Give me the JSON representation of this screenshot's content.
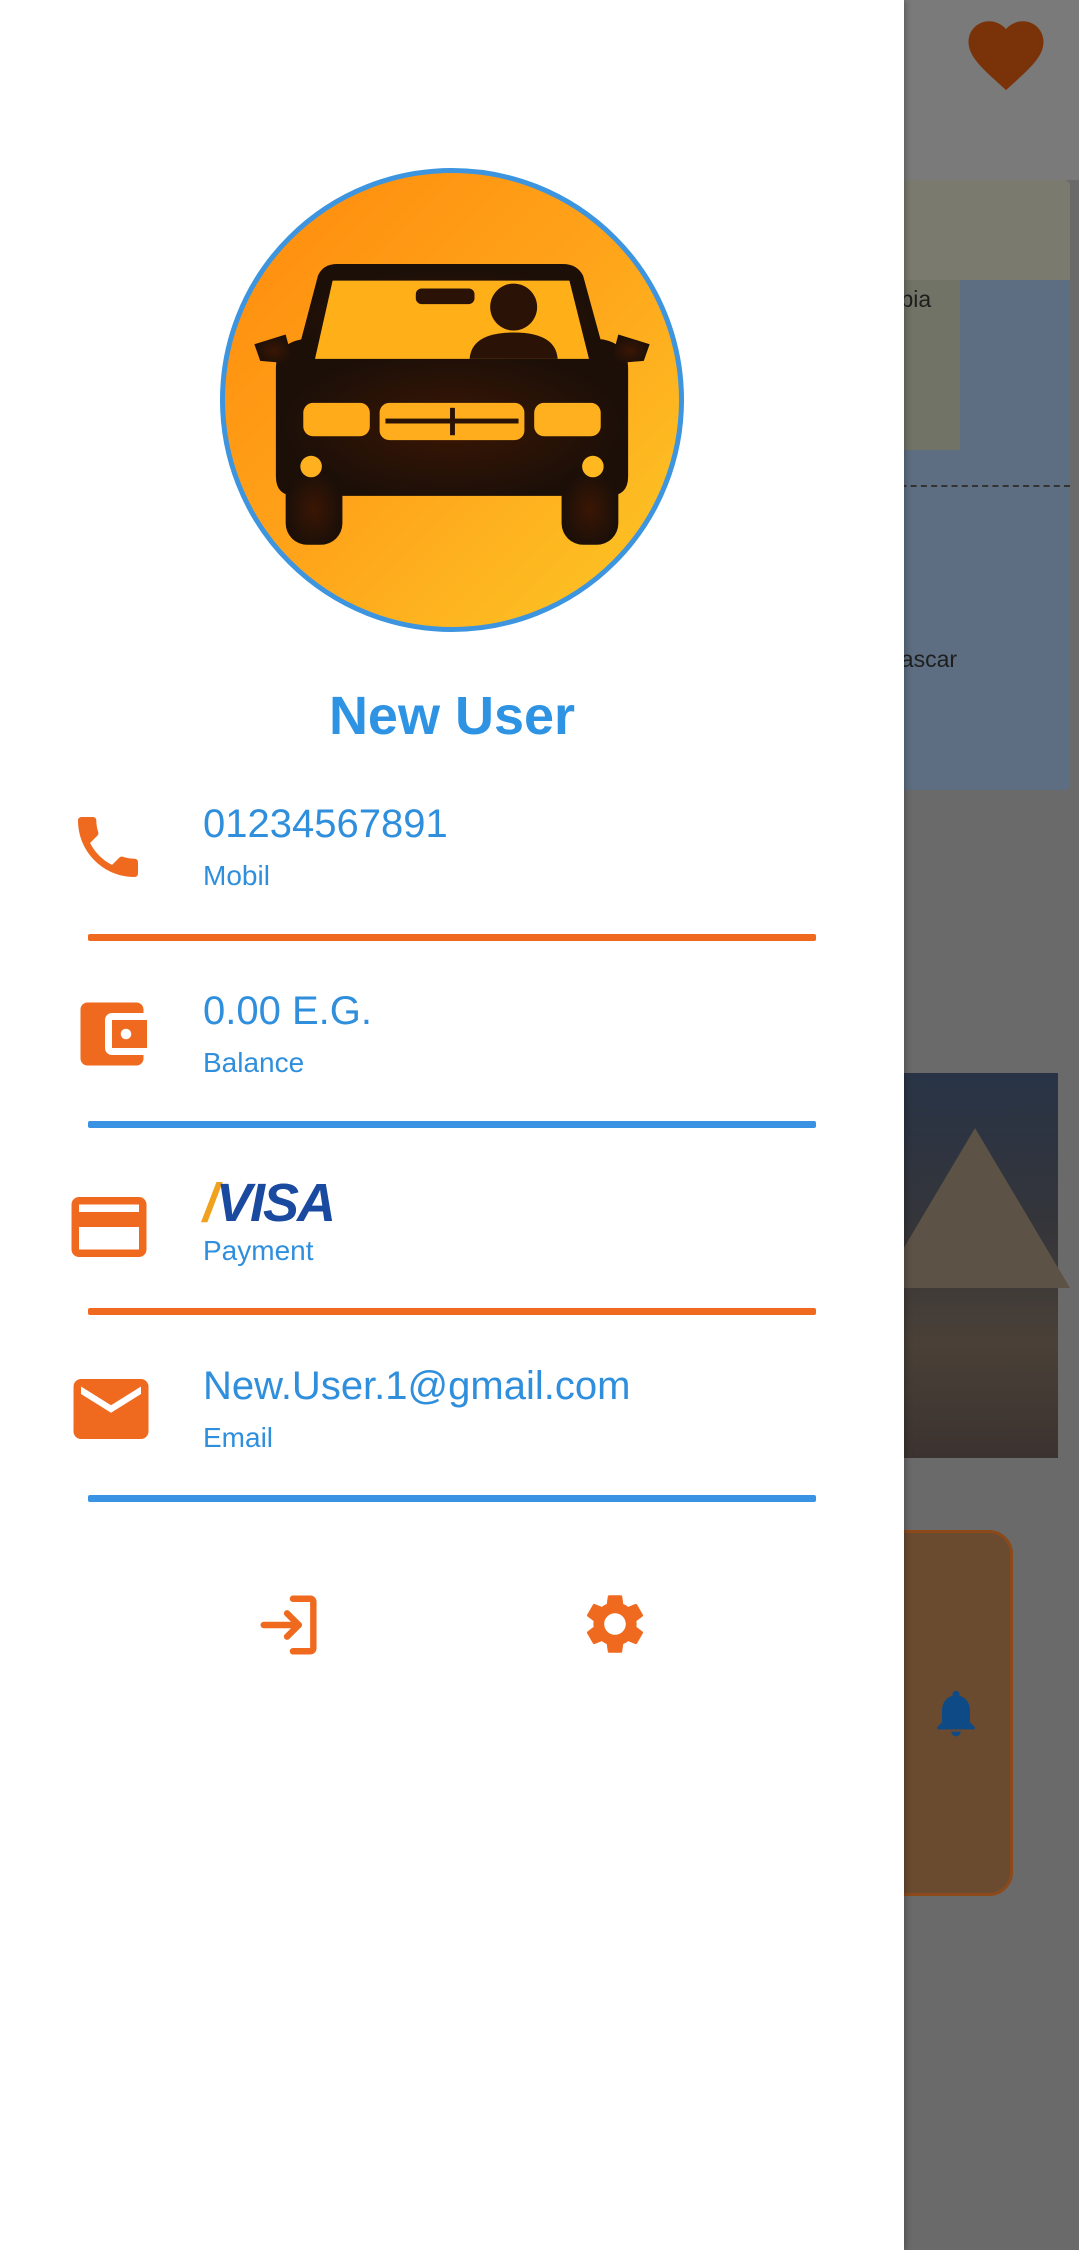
{
  "background": {
    "map_labels": [
      "rabia",
      "gascar"
    ]
  },
  "drawer": {
    "user_name": "New User",
    "items": [
      {
        "value": "01234567891",
        "caption": "Mobil",
        "icon": "phone-icon"
      },
      {
        "value": "0.00 E.G.",
        "caption": "Balance",
        "icon": "wallet-icon"
      },
      {
        "value": "VISA",
        "caption": "Payment",
        "icon": "credit-card-icon"
      },
      {
        "value": "New.User.1@gmail.com",
        "caption": "Email",
        "icon": "email-icon"
      }
    ],
    "actions": [
      {
        "icon": "login-icon"
      },
      {
        "icon": "gear-icon"
      }
    ]
  },
  "colors": {
    "accent_orange": "#ef6a1f",
    "accent_blue": "#2f93e4",
    "avatar_gradient": [
      "#ff8a0c",
      "#fcc826"
    ]
  }
}
